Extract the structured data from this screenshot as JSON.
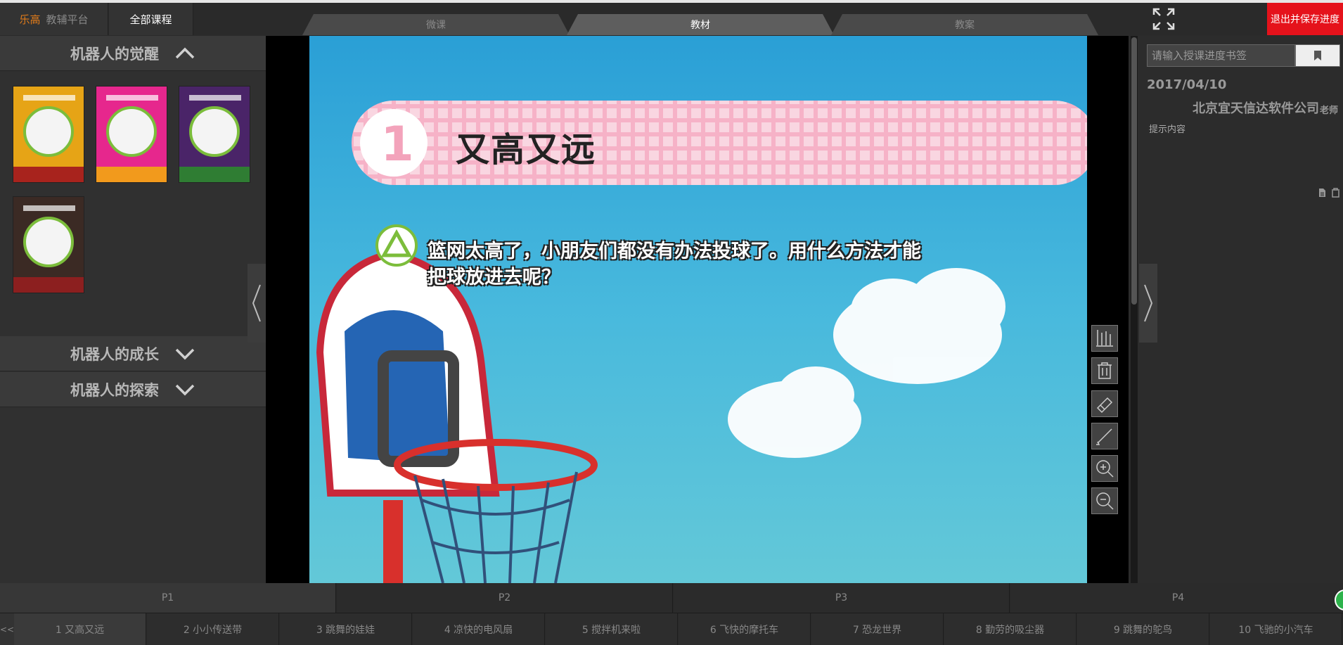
{
  "header": {
    "brand_name": "乐高",
    "brand_sub": "教辅平台",
    "all_courses": "全部课程",
    "tabs": [
      {
        "label": "微课",
        "active": false
      },
      {
        "label": "教材",
        "active": true
      },
      {
        "label": "教案",
        "active": false
      }
    ],
    "exit_button": "退出并保存进度"
  },
  "sidebar": {
    "sections": [
      {
        "title": "机器人的觉醒",
        "expanded": true
      },
      {
        "title": "机器人的成长",
        "expanded": false
      },
      {
        "title": "机器人的探索",
        "expanded": false
      }
    ],
    "book_colors": [
      "#e6a416",
      "#e6278d",
      "#4a2468",
      "#3b2a24"
    ]
  },
  "lesson_page": {
    "number": "1",
    "title": "又高又远",
    "question_line1": "篮网太高了，小朋友们都没有办法投球了。用什么方法才能",
    "question_line2": "把球放进去呢？"
  },
  "right_panel": {
    "bookmark_placeholder": "请输入授课进度书签",
    "date": "2017/04/10",
    "company": "北京宜天信达软件公司",
    "role": "老师",
    "hint": "提示内容"
  },
  "pages": [
    {
      "label": "P1",
      "active": true
    },
    {
      "label": "P2",
      "active": false
    },
    {
      "label": "P3",
      "active": false
    },
    {
      "label": "P4",
      "active": false
    }
  ],
  "lessons": [
    {
      "label": "1 又高又远",
      "active": true
    },
    {
      "label": "2 小小传送带",
      "active": false
    },
    {
      "label": "3 跳舞的娃娃",
      "active": false
    },
    {
      "label": "4 凉快的电风扇",
      "active": false
    },
    {
      "label": "5 搅拌机来啦",
      "active": false
    },
    {
      "label": "6 飞快的摩托车",
      "active": false
    },
    {
      "label": "7 恐龙世界",
      "active": false
    },
    {
      "label": "8 勤劳的吸尘器",
      "active": false
    },
    {
      "label": "9 跳舞的鸵鸟",
      "active": false
    },
    {
      "label": "10 飞驰的小汽车",
      "active": false
    }
  ],
  "nav": {
    "prev_lessons": "<<"
  }
}
